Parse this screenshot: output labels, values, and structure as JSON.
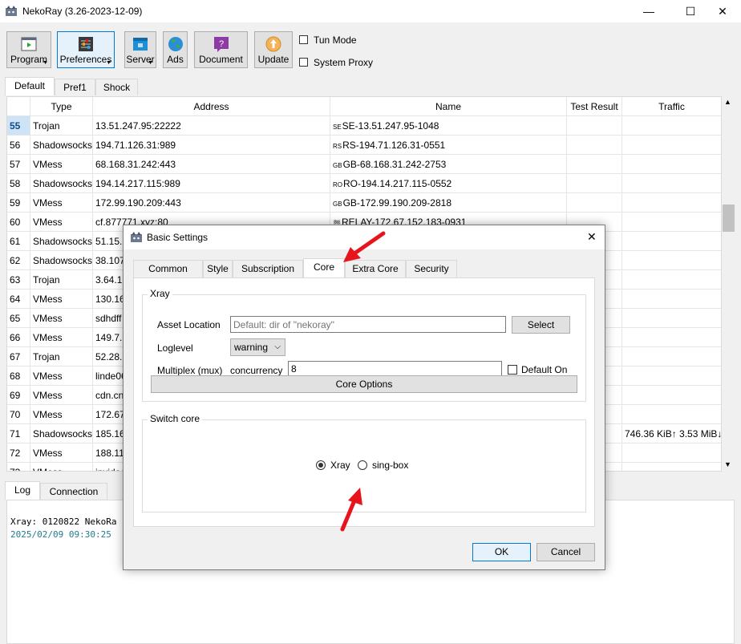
{
  "window": {
    "title": "NekoRay (3.26-2023-12-09)",
    "minimize": "—",
    "maximize": "☐",
    "close": "✕"
  },
  "toolbar": {
    "buttons": [
      {
        "label": "Program",
        "icon": "program-icon",
        "has_menu": true
      },
      {
        "label": "Preferences",
        "icon": "preferences-icon",
        "has_menu": true
      },
      {
        "label": "Server",
        "icon": "server-icon",
        "has_menu": true
      },
      {
        "label": "Ads",
        "icon": "globe-icon",
        "has_menu": false
      },
      {
        "label": "Document",
        "icon": "help-document-icon",
        "has_menu": false
      },
      {
        "label": "Update",
        "icon": "update-icon",
        "has_menu": false
      }
    ],
    "tun_mode": "Tun Mode",
    "system_proxy": "System Proxy"
  },
  "group_tabs": [
    "Default",
    "Pref1",
    "Shock"
  ],
  "table": {
    "headers": [
      "Type",
      "Address",
      "Name",
      "Test Result",
      "Traffic"
    ],
    "rows": [
      {
        "idx": "55",
        "type": "Trojan",
        "address": "13.51.247.95:22222",
        "flag": "SE",
        "name": "SE-13.51.247.95-1048",
        "test": "",
        "traffic": ""
      },
      {
        "idx": "56",
        "type": "Shadowsocks",
        "address": "194.71.126.31:989",
        "flag": "RS",
        "name": "RS-194.71.126.31-0551",
        "test": "",
        "traffic": ""
      },
      {
        "idx": "57",
        "type": "VMess",
        "address": "68.168.31.242:443",
        "flag": "GB",
        "name": "GB-68.168.31.242-2753",
        "test": "",
        "traffic": ""
      },
      {
        "idx": "58",
        "type": "Shadowsocks",
        "address": "194.14.217.115:989",
        "flag": "RO",
        "name": "RO-194.14.217.115-0552",
        "test": "",
        "traffic": ""
      },
      {
        "idx": "59",
        "type": "VMess",
        "address": "172.99.190.209:443",
        "flag": "GB",
        "name": "GB-172.99.190.209-2818",
        "test": "",
        "traffic": ""
      },
      {
        "idx": "60",
        "type": "VMess",
        "address": "cf.877771.xyz:80",
        "flag": "🏁",
        "name": "RELAY-172.67.152.183-0931",
        "test": "",
        "traffic": ""
      },
      {
        "idx": "61",
        "type": "Shadowsocks",
        "address": "51.15.2",
        "flag": "",
        "name": "",
        "test": "",
        "traffic": ""
      },
      {
        "idx": "62",
        "type": "Shadowsocks",
        "address": "38.107.",
        "flag": "",
        "name": "",
        "test": "",
        "traffic": ""
      },
      {
        "idx": "63",
        "type": "Trojan",
        "address": "3.64.17",
        "flag": "",
        "name": "",
        "test": "",
        "traffic": ""
      },
      {
        "idx": "64",
        "type": "VMess",
        "address": "130.16",
        "flag": "",
        "name": "",
        "test": "",
        "traffic": ""
      },
      {
        "idx": "65",
        "type": "VMess",
        "address": "sdhdff",
        "flag": "",
        "name": "",
        "test": "",
        "traffic": ""
      },
      {
        "idx": "66",
        "type": "VMess",
        "address": "149.7.1",
        "flag": "",
        "name": "",
        "test": "",
        "traffic": ""
      },
      {
        "idx": "67",
        "type": "Trojan",
        "address": "52.28.1",
        "flag": "",
        "name": "",
        "test": "",
        "traffic": ""
      },
      {
        "idx": "68",
        "type": "VMess",
        "address": "linde06",
        "flag": "",
        "name": "",
        "test": "",
        "traffic": ""
      },
      {
        "idx": "69",
        "type": "VMess",
        "address": "cdn.cn",
        "flag": "",
        "name": "",
        "test": "",
        "traffic": ""
      },
      {
        "idx": "70",
        "type": "VMess",
        "address": "172.67",
        "flag": "",
        "name": "",
        "test": "",
        "traffic": ""
      },
      {
        "idx": "71",
        "type": "Shadowsocks",
        "address": "185.16",
        "flag": "",
        "name": "",
        "test": "",
        "traffic": "746.36 KiB↑ 3.53 MiB↓"
      },
      {
        "idx": "72",
        "type": "VMess",
        "address": "188.11",
        "flag": "",
        "name": "",
        "test": "",
        "traffic": ""
      },
      {
        "idx": "73",
        "type": "VMess",
        "address": "invideo",
        "flag": "",
        "name": "",
        "test": "",
        "traffic": ""
      }
    ]
  },
  "bottom_tabs": [
    "Log",
    "Connection"
  ],
  "log": {
    "line1": "Xray: 0120822 NekoRa",
    "line2": "2025/02/09 09:30:25"
  },
  "dialog": {
    "title": "Basic Settings",
    "close": "✕",
    "tabs": [
      "Common",
      "Style",
      "Subscription",
      "Core",
      "Extra Core",
      "Security"
    ],
    "selected_tab": "Core",
    "xray_group": {
      "title": "Xray",
      "asset_location_label": "Asset Location",
      "asset_location_placeholder": "Default: dir of \"nekoray\"",
      "select_button": "Select",
      "loglevel_label": "Loglevel",
      "loglevel_value": "warning",
      "multiplex_label": "Multiplex (mux)",
      "concurrency_label": "concurrency",
      "concurrency_value": "8",
      "default_on_label": "Default On",
      "core_options_button": "Core Options"
    },
    "switch_core": {
      "title": "Switch core",
      "options": [
        "Xray",
        "sing-box"
      ],
      "selected": "Xray"
    },
    "ok": "OK",
    "cancel": "Cancel"
  },
  "colors": {
    "selection": "#cfe3f7",
    "accent": "#0078d7",
    "log_timestamp": "#1f7a8c",
    "annotation_arrow": "#e8141c"
  }
}
